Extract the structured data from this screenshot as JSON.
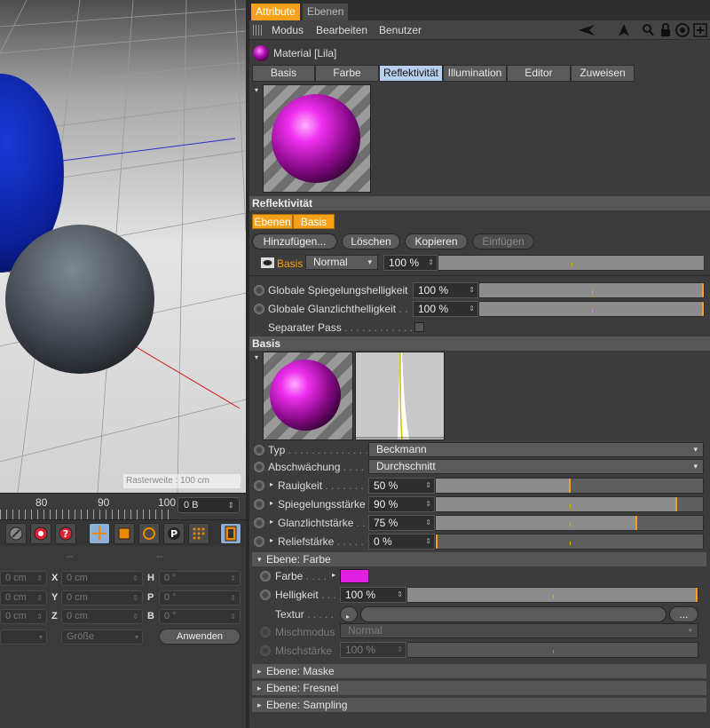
{
  "viewport": {
    "hud_text": "Rasterweite : 100 cm"
  },
  "timeline": {
    "ticks": [
      "80",
      "90",
      "100"
    ],
    "frame_field": "0 B"
  },
  "toolbar": {
    "icons": [
      "lock-icon",
      "record-icon",
      "help-icon",
      "move-icon",
      "scale-icon",
      "rotate-icon",
      "parking-icon",
      "points-icon",
      "film-icon"
    ]
  },
  "coords": {
    "headers": [
      "--",
      "--"
    ],
    "rows": [
      {
        "pos_value": "0 cm",
        "size_label": "X",
        "size_value": "0 cm",
        "rot_label": "H",
        "rot_value": "0 °"
      },
      {
        "pos_value": "0 cm",
        "size_label": "Y",
        "size_value": "0 cm",
        "rot_label": "P",
        "rot_value": "0 °"
      },
      {
        "pos_value": "0 cm",
        "size_label": "Z",
        "size_value": "0 cm",
        "rot_label": "B",
        "rot_value": "0 °"
      }
    ],
    "size_mode": "Größe",
    "apply_label": "Anwenden"
  },
  "panel": {
    "tabs": [
      "Attribute",
      "Ebenen"
    ],
    "menu": [
      "Modus",
      "Bearbeiten",
      "Benutzer"
    ],
    "material_title": "Material [Lila]",
    "sub_tabs": [
      "Basis",
      "Farbe",
      "Reflektivität",
      "Illumination",
      "Editor",
      "Zuweisen"
    ],
    "reflect_section": "Reflektivität",
    "layer_tabs": [
      "Ebenen",
      "Basis"
    ],
    "layer_buttons": [
      "Hinzufügen...",
      "Löschen",
      "Kopieren",
      "Einfügen"
    ],
    "layer_row": {
      "name": "Basis",
      "mode": "Normal",
      "value": "100 %"
    },
    "global": [
      {
        "label": "Globale Spiegelungshelligkeit",
        "value": "100 %"
      },
      {
        "label": "Globale Glanzlichthelligkeit",
        "value": "100 %"
      }
    ],
    "separate_pass": "Separater Pass",
    "basis_section": "Basis",
    "typ": {
      "label": "Typ",
      "value": "Beckmann"
    },
    "abschwaechung": {
      "label": "Abschwächung",
      "value": "Durchschnitt"
    },
    "params": [
      {
        "label": "Rauigkeit",
        "value": "50 %",
        "level": 0.5
      },
      {
        "label": "Spiegelungsstärke",
        "value": "90 %",
        "level": 0.9
      },
      {
        "label": "Glanzlichtstärke",
        "value": "75 %",
        "level": 0.75
      },
      {
        "label": "Reliefstärke",
        "value": "0 %",
        "level": 0.0
      }
    ],
    "farbe_section": "Ebene: Farbe",
    "farbe": {
      "label": "Farbe",
      "color": "#e020e0"
    },
    "helligkeit": {
      "label": "Helligkeit",
      "value": "100 %",
      "level": 1.0
    },
    "textur_label": "Textur",
    "textur_btn": "...",
    "mischmodus": {
      "label": "Mischmodus",
      "value": "Normal"
    },
    "mischstaerke": {
      "label": "Mischstärke",
      "value": "100 %"
    },
    "collapsed": [
      "Ebene: Maske",
      "Ebene: Fresnel",
      "Ebene: Sampling"
    ]
  }
}
